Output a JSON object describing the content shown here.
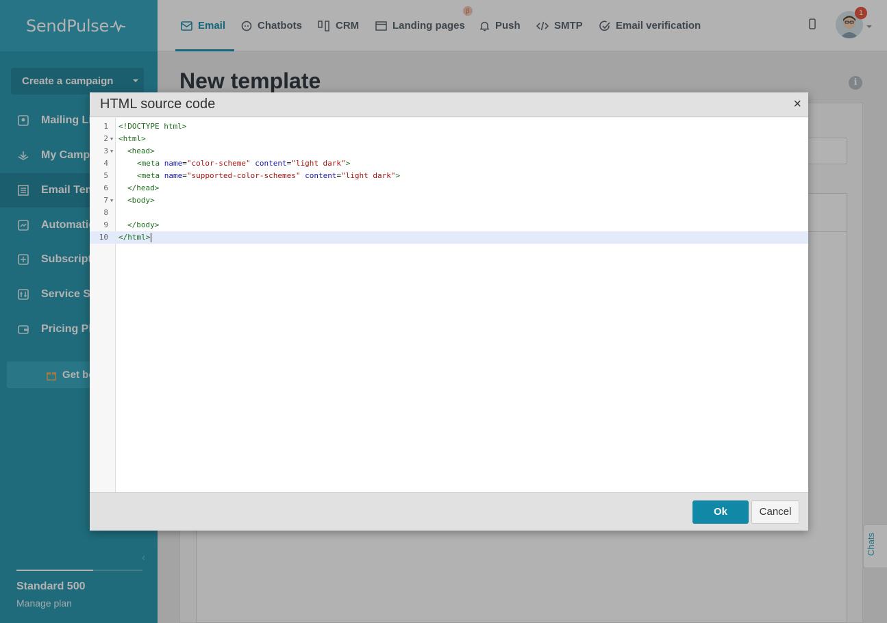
{
  "app": {
    "logo": "SendPulse"
  },
  "sidebar": {
    "create_button": "Create a campaign",
    "items": [
      {
        "label": "Mailing Li",
        "icon": "contacts-icon"
      },
      {
        "label": "My Campa",
        "icon": "campaign-icon"
      },
      {
        "label": "Email Tem",
        "icon": "template-icon"
      },
      {
        "label": "Automatio",
        "icon": "automation-icon"
      },
      {
        "label": "Subscripti",
        "icon": "subscription-form-icon"
      },
      {
        "label": "Service Se",
        "icon": "settings-sliders-icon"
      },
      {
        "label": "Pricing Pl",
        "icon": "wallet-icon"
      }
    ],
    "active_index": 2,
    "bonus": "Get bo",
    "plan_name": "Standard 500",
    "plan_manage": "Manage plan",
    "plan_progress": 0.61
  },
  "topnav": {
    "tabs": [
      {
        "label": "Email",
        "icon": "envelope-icon",
        "active": true
      },
      {
        "label": "Chatbots",
        "icon": "chat-bubble-icon"
      },
      {
        "label": "CRM",
        "icon": "kanban-icon"
      },
      {
        "label": "Landing pages",
        "icon": "landing-page-icon",
        "badge": "β"
      },
      {
        "label": "Push",
        "icon": "bell-icon"
      },
      {
        "label": "SMTP",
        "icon": "code-icon"
      },
      {
        "label": "Email verification",
        "icon": "check-circle-icon"
      }
    ],
    "notifications": "1"
  },
  "main": {
    "title": "New template"
  },
  "chats_tab": "Chats",
  "modal": {
    "title": "HTML source code",
    "close": "×",
    "ok": "Ok",
    "cancel": "Cancel",
    "code_lines": [
      {
        "n": "1",
        "fold": false
      },
      {
        "n": "2",
        "fold": true
      },
      {
        "n": "3",
        "fold": true
      },
      {
        "n": "4",
        "fold": false
      },
      {
        "n": "5",
        "fold": false
      },
      {
        "n": "6",
        "fold": false
      },
      {
        "n": "7",
        "fold": true
      },
      {
        "n": "8",
        "fold": false
      },
      {
        "n": "9",
        "fold": false
      },
      {
        "n": "10",
        "fold": false
      }
    ],
    "code": {
      "l1": "<!DOCTYPE html>",
      "l2": "<html>",
      "l3": "<head>",
      "l4_tag": "<meta",
      "l4_attr1": "name",
      "l4_val1": "\"color-scheme\"",
      "l4_attr2": "content",
      "l4_val2": "\"light dark\"",
      "l4_end": ">",
      "l5_tag": "<meta",
      "l5_attr1": "name",
      "l5_val1": "\"supported-color-schemes\"",
      "l5_attr2": "content",
      "l5_val2": "\"light dark\"",
      "l5_end": ">",
      "l6": "</head>",
      "l7": "<body>",
      "l9": "</body>",
      "l10": "</html>"
    }
  },
  "colors": {
    "brand": "#2d9ab1",
    "accent": "#1088a6",
    "active_tab": "#1c94b0"
  }
}
